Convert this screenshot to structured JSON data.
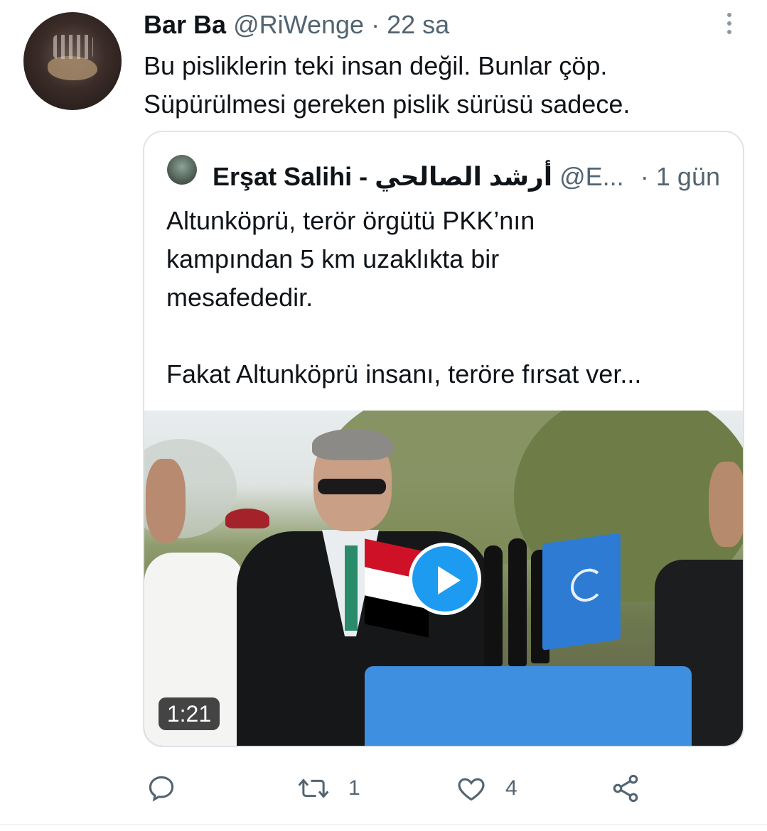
{
  "tweet": {
    "author_name": "Bar Ba",
    "handle": "@RiWenge",
    "separator": "·",
    "time": "22 sa",
    "text_lines": [
      "Bu pisliklerin teki insan değil. Bunlar çöp.",
      "Süpürülmesi gereken pislik sürüsü sadece."
    ]
  },
  "quoted": {
    "author_name": "Erşat Salihi - أرشد الصالحي",
    "handle": "@E...",
    "time": "· 1 gün",
    "text_lines": [
      "Altunköprü, terör örgütü PKK’nın",
      "kampından 5 km uzaklıkta bir",
      "mesafededir.",
      "",
      "Fakat Altunköprü insanı, teröre fırsat ver..."
    ],
    "video": {
      "duration": "1:21"
    }
  },
  "actions": {
    "reply_count": "",
    "retweet_count": "1",
    "like_count": "4"
  },
  "icons": {
    "more": "more-vertical-icon",
    "reply": "reply-icon",
    "retweet": "retweet-icon",
    "like": "heart-icon",
    "share": "share-icon",
    "play": "play-icon"
  },
  "colors": {
    "accent": "#1d9bf0",
    "text": "#0f1419",
    "muted": "#536471",
    "border": "#dfe3e8"
  }
}
